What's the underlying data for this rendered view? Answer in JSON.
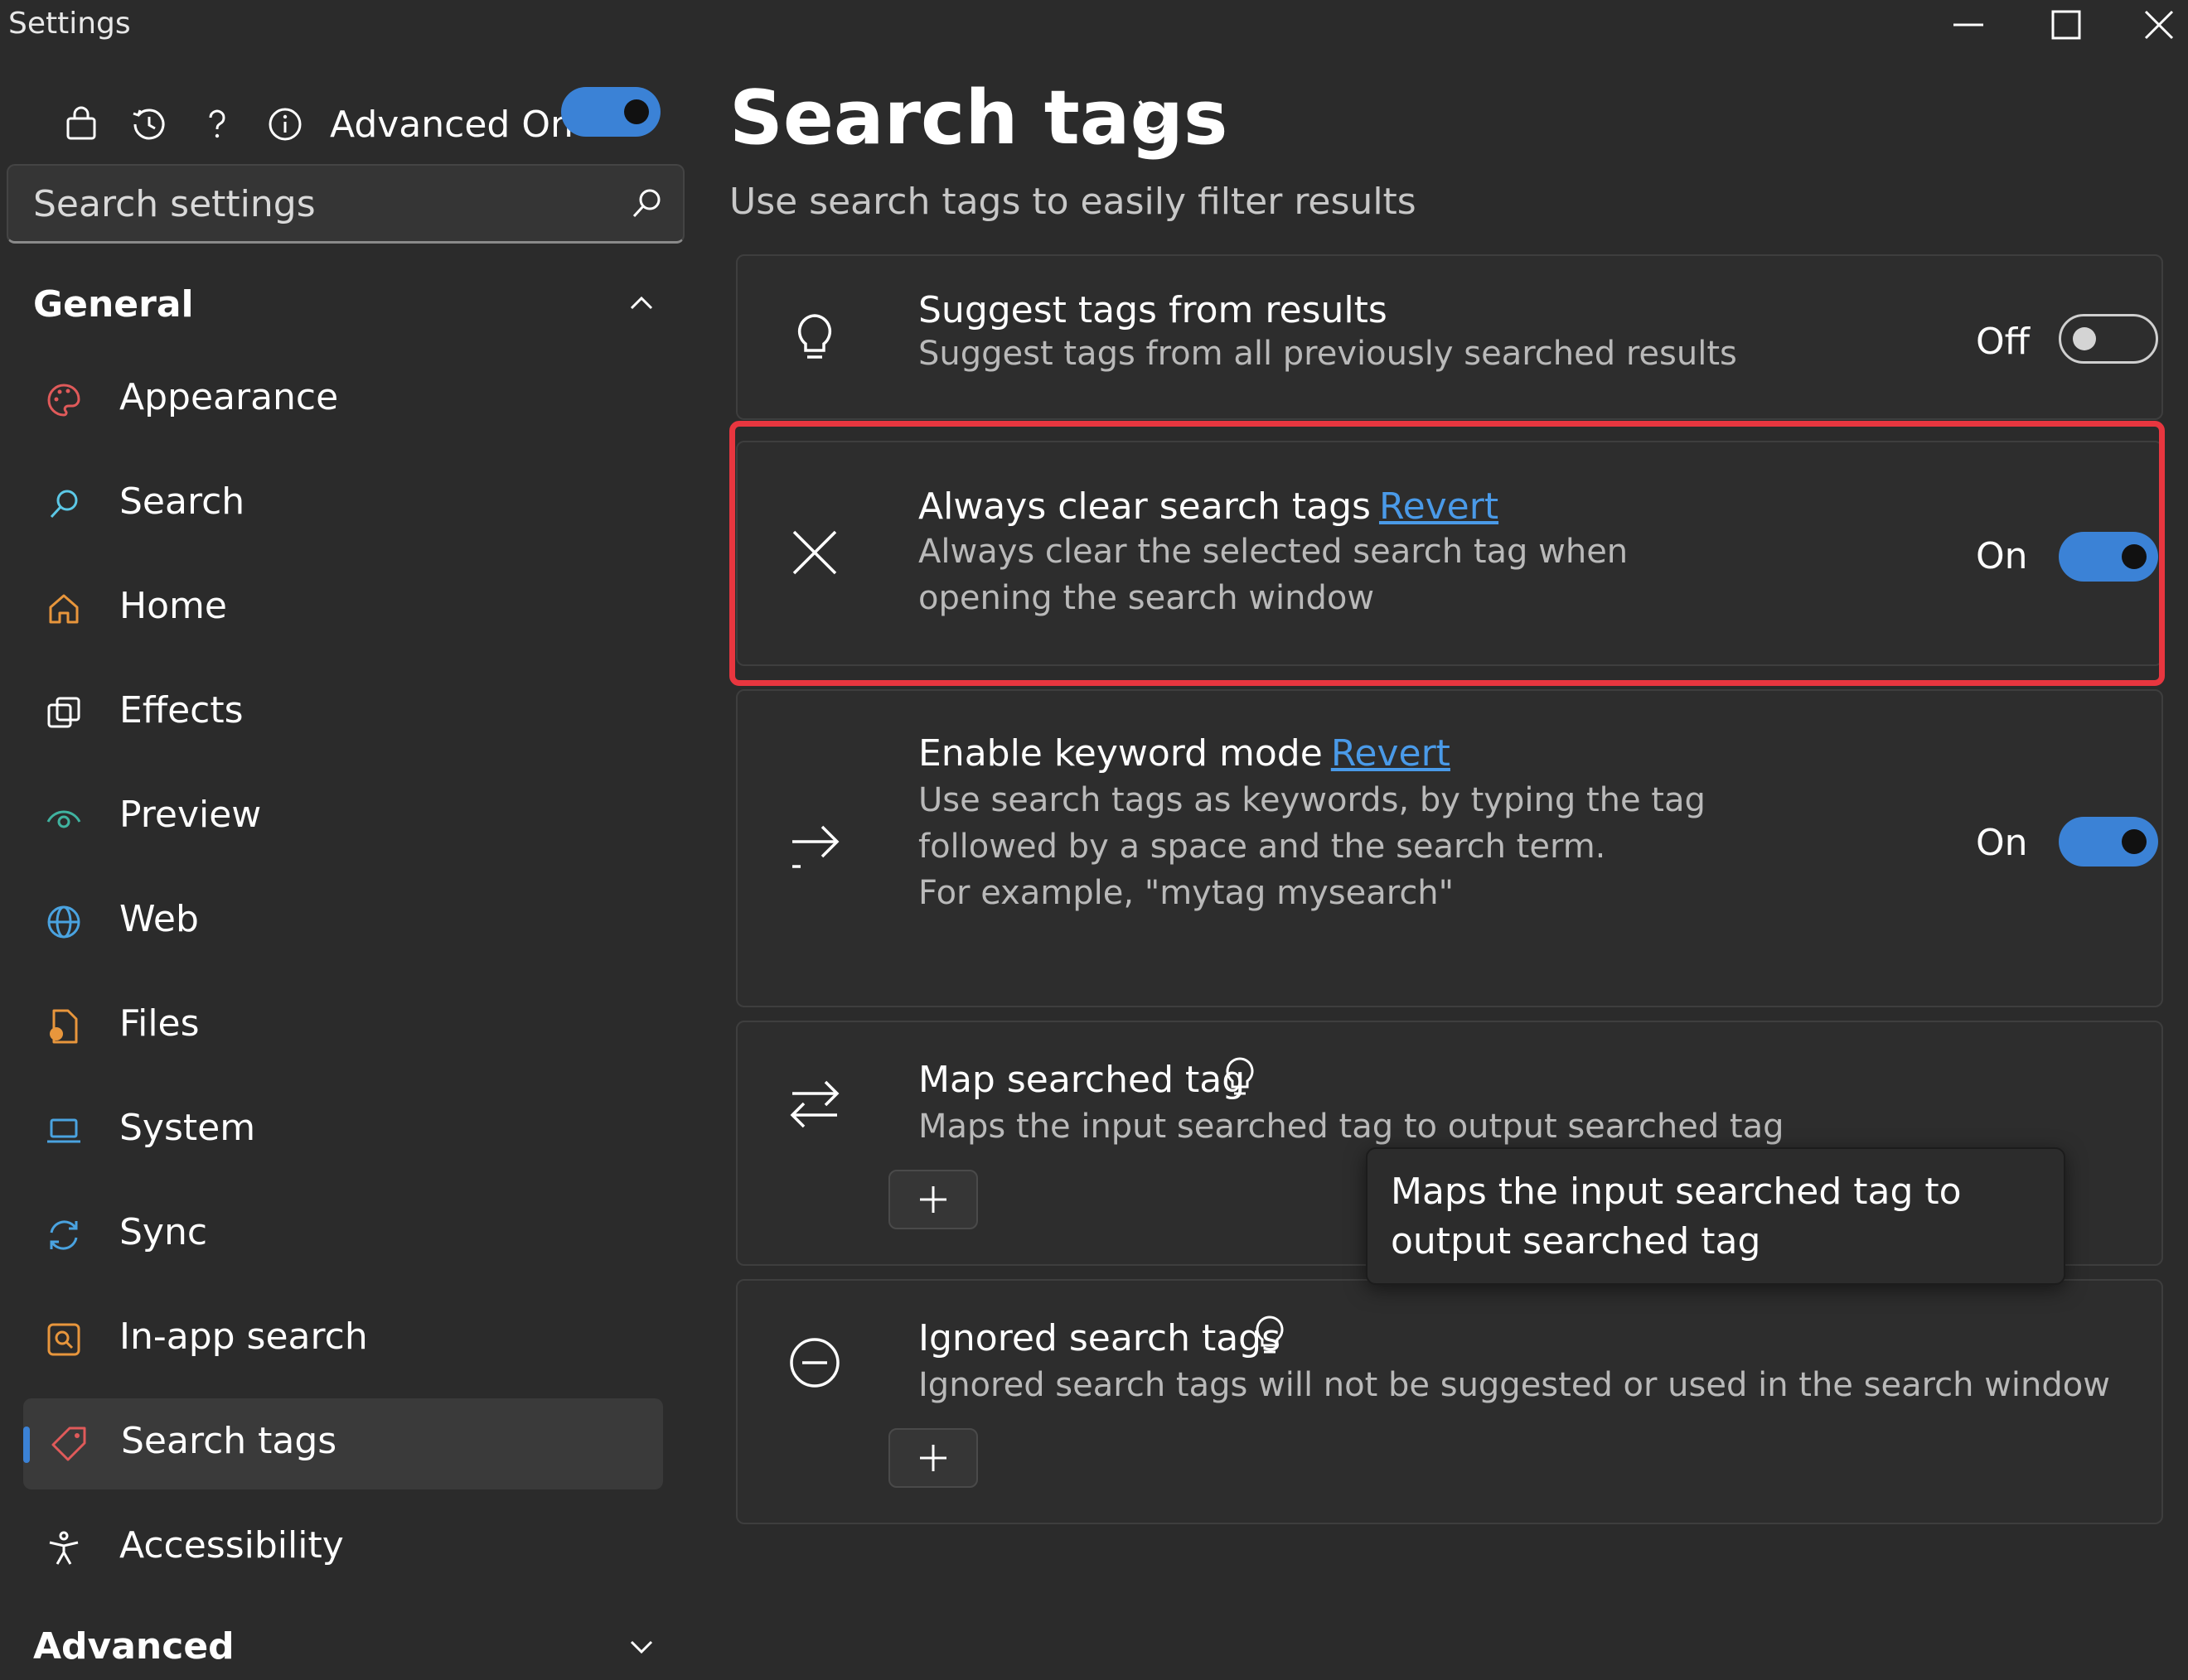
{
  "window": {
    "title": "Settings"
  },
  "toolbar": {
    "advanced_label": "Advanced On",
    "advanced_toggle": true
  },
  "search": {
    "placeholder": "Search settings"
  },
  "sidebar": {
    "sections": [
      {
        "label": "General",
        "expanded": true
      },
      {
        "label": "Advanced",
        "expanded": false
      }
    ],
    "items": [
      {
        "label": "Appearance",
        "icon": "palette-icon"
      },
      {
        "label": "Search",
        "icon": "search-icon"
      },
      {
        "label": "Home",
        "icon": "home-icon"
      },
      {
        "label": "Effects",
        "icon": "effects-icon"
      },
      {
        "label": "Preview",
        "icon": "preview-eye-icon"
      },
      {
        "label": "Web",
        "icon": "globe-icon"
      },
      {
        "label": "Files",
        "icon": "file-icon"
      },
      {
        "label": "System",
        "icon": "laptop-icon"
      },
      {
        "label": "Sync",
        "icon": "sync-icon"
      },
      {
        "label": "In-app search",
        "icon": "in-app-search-icon"
      },
      {
        "label": "Search tags",
        "icon": "tag-icon",
        "selected": true
      },
      {
        "label": "Accessibility",
        "icon": "accessibility-icon"
      }
    ]
  },
  "page": {
    "title": "Search tags",
    "subtitle": "Use search tags to easily filter results"
  },
  "settings": [
    {
      "title": "Suggest tags from results",
      "description": "Suggest tags from all previously searched results",
      "state": "Off",
      "toggle": false,
      "icon": "lightbulb-icon"
    },
    {
      "title": "Always clear search tags",
      "revert": "Revert",
      "description_lines": [
        "Always clear the selected search tag when",
        "opening the search window"
      ],
      "state": "On",
      "toggle": true,
      "icon": "close-x-icon"
    },
    {
      "title": "Enable keyword mode",
      "revert": "Revert",
      "description_lines": [
        "Use search tags as keywords, by typing the tag",
        "followed by a space and the search term.",
        "For example, \"mytag mysearch\""
      ],
      "state": "On",
      "toggle": true,
      "icon": "arrow-right-icon"
    },
    {
      "title": "Map searched tag",
      "description": "Maps the input searched tag to output searched tag",
      "icon": "swap-arrows-icon"
    },
    {
      "title": "Ignored search tags",
      "description": "Ignored search tags will not be suggested or used in the search window",
      "icon": "minus-circle-icon"
    }
  ],
  "tooltip": {
    "text": "Maps the input searched tag to output searched tag"
  },
  "colors": {
    "accent": "#3b82d6",
    "link": "#4a9ae8",
    "highlight": "#e8363f",
    "background": "#2b2b2b"
  }
}
